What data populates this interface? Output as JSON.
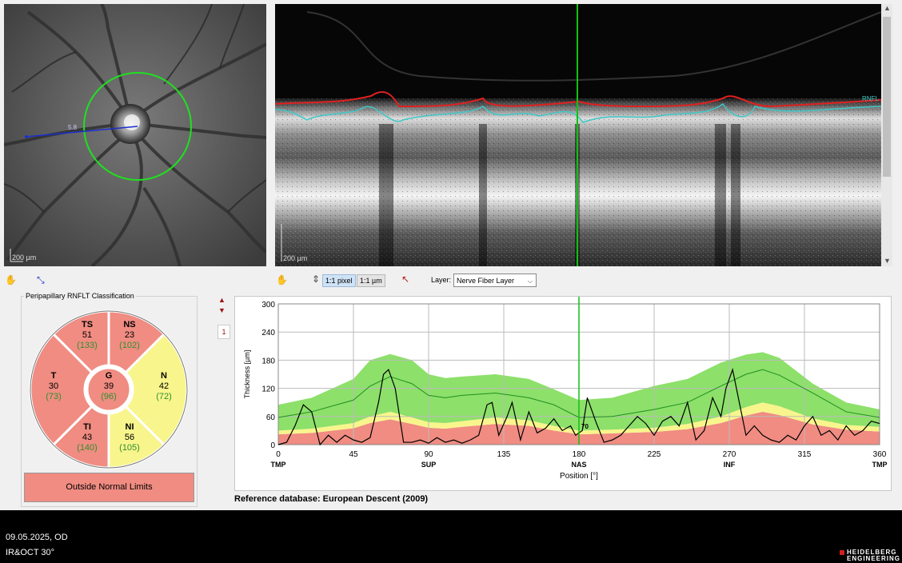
{
  "fundus": {
    "scalebar_label": "200 µm",
    "distance_label": "5.8"
  },
  "bscan": {
    "scalebar_label": "200 µm",
    "rnfl_label": "RNFL"
  },
  "toolbar": {
    "pixel_btn": "1:1 pixel",
    "um_btn": "1:1 µm",
    "layer_label": "Layer:",
    "layer_value": "Nerve Fiber Layer"
  },
  "classification": {
    "title": "Peripapillary RNFLT Classification",
    "sectors": [
      {
        "id": "TS",
        "value": "51",
        "ref": "(133)",
        "status": "outside"
      },
      {
        "id": "NS",
        "value": "23",
        "ref": "(102)",
        "status": "outside"
      },
      {
        "id": "N",
        "value": "42",
        "ref": "(72)",
        "status": "borderline"
      },
      {
        "id": "NI",
        "value": "56",
        "ref": "(105)",
        "status": "borderline"
      },
      {
        "id": "TI",
        "value": "43",
        "ref": "(140)",
        "status": "outside"
      },
      {
        "id": "T",
        "value": "30",
        "ref": "(73)",
        "status": "outside"
      },
      {
        "id": "G",
        "value": "39",
        "ref": "(96)",
        "status": "outside"
      }
    ],
    "result": "Outside Normal Limits"
  },
  "colors": {
    "outside": "#f08c82",
    "borderline": "#f8f58c",
    "normal": "#8de06a",
    "value_ref": "#2f8f2f",
    "cursor": "#10c010"
  },
  "graph": {
    "page_marker": "1",
    "cursor_value": "70",
    "reference_db": "Reference database: European Descent (2009)"
  },
  "chart_data": {
    "type": "line",
    "xlabel": "Position [°]",
    "ylabel": "Thickness [µm]",
    "xlim": [
      0,
      360
    ],
    "ylim": [
      0,
      300
    ],
    "x_ticks": [
      0,
      45,
      90,
      135,
      180,
      225,
      270,
      315,
      360
    ],
    "y_ticks": [
      0,
      60,
      120,
      180,
      240,
      300
    ],
    "region_labels": [
      {
        "x": 0,
        "label": "TMP"
      },
      {
        "x": 90,
        "label": "SUP"
      },
      {
        "x": 180,
        "label": "NAS"
      },
      {
        "x": 270,
        "label": "INF"
      },
      {
        "x": 360,
        "label": "TMP"
      }
    ],
    "cursor_x": 180,
    "normal_band": {
      "x": [
        0,
        20,
        45,
        55,
        67,
        80,
        90,
        100,
        110,
        130,
        150,
        165,
        180,
        200,
        225,
        245,
        265,
        280,
        290,
        300,
        320,
        340,
        360
      ],
      "lower": [
        30,
        34,
        46,
        60,
        70,
        58,
        48,
        46,
        50,
        58,
        52,
        40,
        30,
        32,
        36,
        44,
        60,
        80,
        90,
        82,
        56,
        42,
        38
      ],
      "upper": [
        85,
        100,
        140,
        180,
        193,
        180,
        150,
        142,
        145,
        150,
        140,
        118,
        95,
        100,
        125,
        140,
        175,
        192,
        197,
        185,
        130,
        90,
        75
      ]
    },
    "borderline_band": {
      "x": [
        0,
        20,
        45,
        55,
        67,
        80,
        90,
        100,
        110,
        130,
        150,
        165,
        180,
        200,
        225,
        245,
        265,
        280,
        290,
        300,
        320,
        340,
        360
      ],
      "lower": [
        22,
        25,
        35,
        46,
        54,
        44,
        36,
        34,
        38,
        44,
        40,
        30,
        22,
        24,
        27,
        33,
        46,
        62,
        70,
        63,
        43,
        32,
        28
      ],
      "upper": [
        30,
        34,
        46,
        60,
        70,
        58,
        48,
        46,
        50,
        58,
        52,
        40,
        30,
        32,
        36,
        44,
        60,
        80,
        90,
        82,
        56,
        42,
        38
      ]
    },
    "series": [
      {
        "name": "mean",
        "x": [
          0,
          20,
          45,
          55,
          67,
          80,
          90,
          100,
          110,
          130,
          150,
          165,
          180,
          200,
          225,
          245,
          265,
          280,
          290,
          300,
          320,
          340,
          360
        ],
        "values": [
          58,
          70,
          95,
          125,
          145,
          130,
          105,
          100,
          105,
          110,
          100,
          85,
          58,
          60,
          75,
          90,
          125,
          150,
          160,
          148,
          110,
          70,
          58
        ]
      },
      {
        "name": "measured",
        "x": [
          0,
          5,
          10,
          15,
          20,
          25,
          30,
          35,
          40,
          45,
          50,
          55,
          60,
          63,
          66,
          70,
          75,
          80,
          85,
          90,
          95,
          100,
          105,
          110,
          115,
          120,
          125,
          128,
          132,
          137,
          140,
          145,
          150,
          155,
          160,
          165,
          170,
          175,
          178,
          182,
          185,
          190,
          195,
          200,
          205,
          210,
          215,
          220,
          225,
          230,
          235,
          240,
          245,
          250,
          255,
          260,
          265,
          268,
          272,
          276,
          280,
          285,
          290,
          295,
          300,
          305,
          310,
          315,
          320,
          325,
          330,
          335,
          340,
          345,
          350,
          355,
          360
        ],
        "values": [
          0,
          5,
          40,
          85,
          70,
          0,
          20,
          5,
          20,
          10,
          5,
          15,
          90,
          150,
          160,
          120,
          5,
          5,
          10,
          3,
          15,
          5,
          10,
          3,
          10,
          20,
          85,
          90,
          20,
          60,
          90,
          10,
          70,
          25,
          35,
          55,
          30,
          40,
          20,
          30,
          100,
          50,
          5,
          10,
          20,
          40,
          60,
          45,
          20,
          50,
          60,
          40,
          90,
          10,
          30,
          100,
          60,
          120,
          160,
          90,
          20,
          40,
          20,
          10,
          5,
          20,
          10,
          40,
          60,
          20,
          30,
          10,
          40,
          20,
          30,
          50,
          45
        ]
      }
    ]
  },
  "footer": {
    "date_eye": "09.05.2025, OD",
    "modality": "IR&OCT 30°",
    "brand_line1": "HEIDELBERG",
    "brand_line2": "ENGINEERING"
  }
}
